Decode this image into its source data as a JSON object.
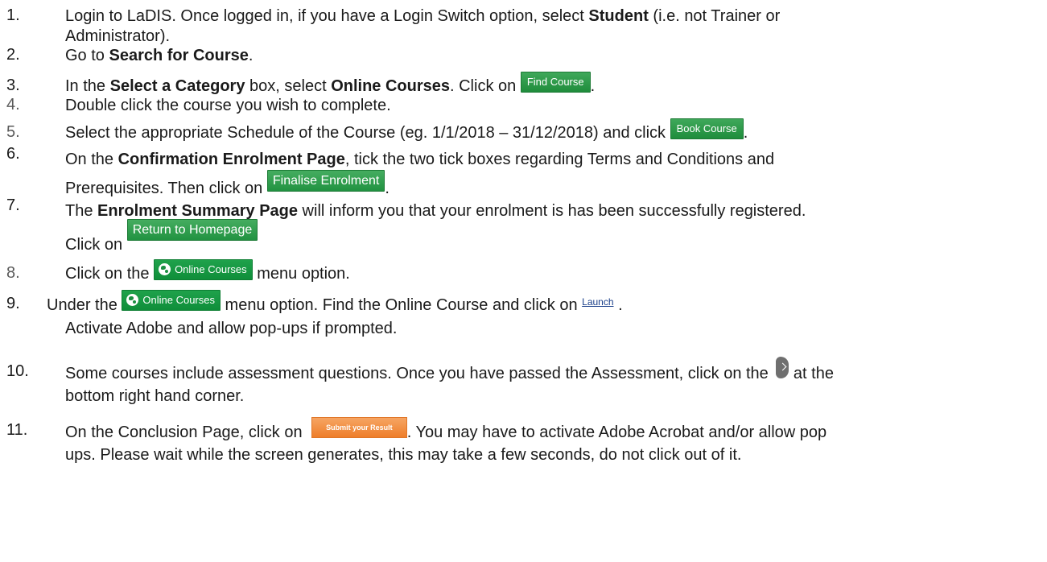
{
  "steps": [
    {
      "num": "1.",
      "a": "Login to LaDIS. Once logged in, if you have a Login Switch option, select ",
      "b": "Student",
      "c": " (i.e. not Trainer or",
      "d": "Administrator)."
    },
    {
      "num": "2.",
      "a": "Go to ",
      "b": "Search for Course",
      "c": "."
    },
    {
      "num": "3.",
      "a": "In the ",
      "b": "Select a Category",
      "c": " box, select ",
      "d": "Online Courses",
      "e": ". Click on ",
      "btn": "Find Course",
      "f": "."
    },
    {
      "num": "4.",
      "a": "Double click the course you wish to complete."
    },
    {
      "num": "5.",
      "a": "Select the appropriate Schedule of the Course (eg. 1/1/2018 – 31/12/2018) and click ",
      "btn": "Book Course",
      "f": "."
    },
    {
      "num": "6.",
      "a": "On the ",
      "b": "Confirmation Enrolment Page",
      "c": ", tick the two tick boxes regarding Terms and Conditions and",
      "d": "Prerequisites. Then click on ",
      "btn": "Finalise Enrolment",
      "f": "."
    },
    {
      "num": "7.",
      "a": "The ",
      "b": "Enrolment Summary Page",
      "c": " will inform you that your enrolment is has been successfully registered.",
      "d": "Click on ",
      "btn": "Return to Homepage"
    },
    {
      "num": "8.",
      "a": "Click on the ",
      "btn": "Online Courses",
      "c": " menu option."
    },
    {
      "num": "9.",
      "a": "Under the ",
      "btn": "Online Courses",
      "c": " menu option. Find the Online Course and click on ",
      "link": "Launch",
      "f": " .",
      "d": "Activate Adobe and allow pop-ups if prompted."
    },
    {
      "num": "10.",
      "a": "Some courses include assessment questions.  Once you have passed the Assessment, click on the ",
      "c": " at the",
      "d": "bottom right hand corner."
    },
    {
      "num": "11.",
      "a": "On the Conclusion Page, click on ",
      "btn": "Submit your Result",
      "c": ". You may have to activate Adobe Acrobat and/or allow pop",
      "d": "ups. Please wait while the screen generates, this may take a few seconds, do not click out of it."
    }
  ],
  "icons": {
    "globe": "globe-icon",
    "next_arrow": "chevron-right-icon"
  },
  "colors": {
    "green_button": "#219241",
    "orange_button": "#ee7e2a",
    "link": "#1a3f8a"
  }
}
